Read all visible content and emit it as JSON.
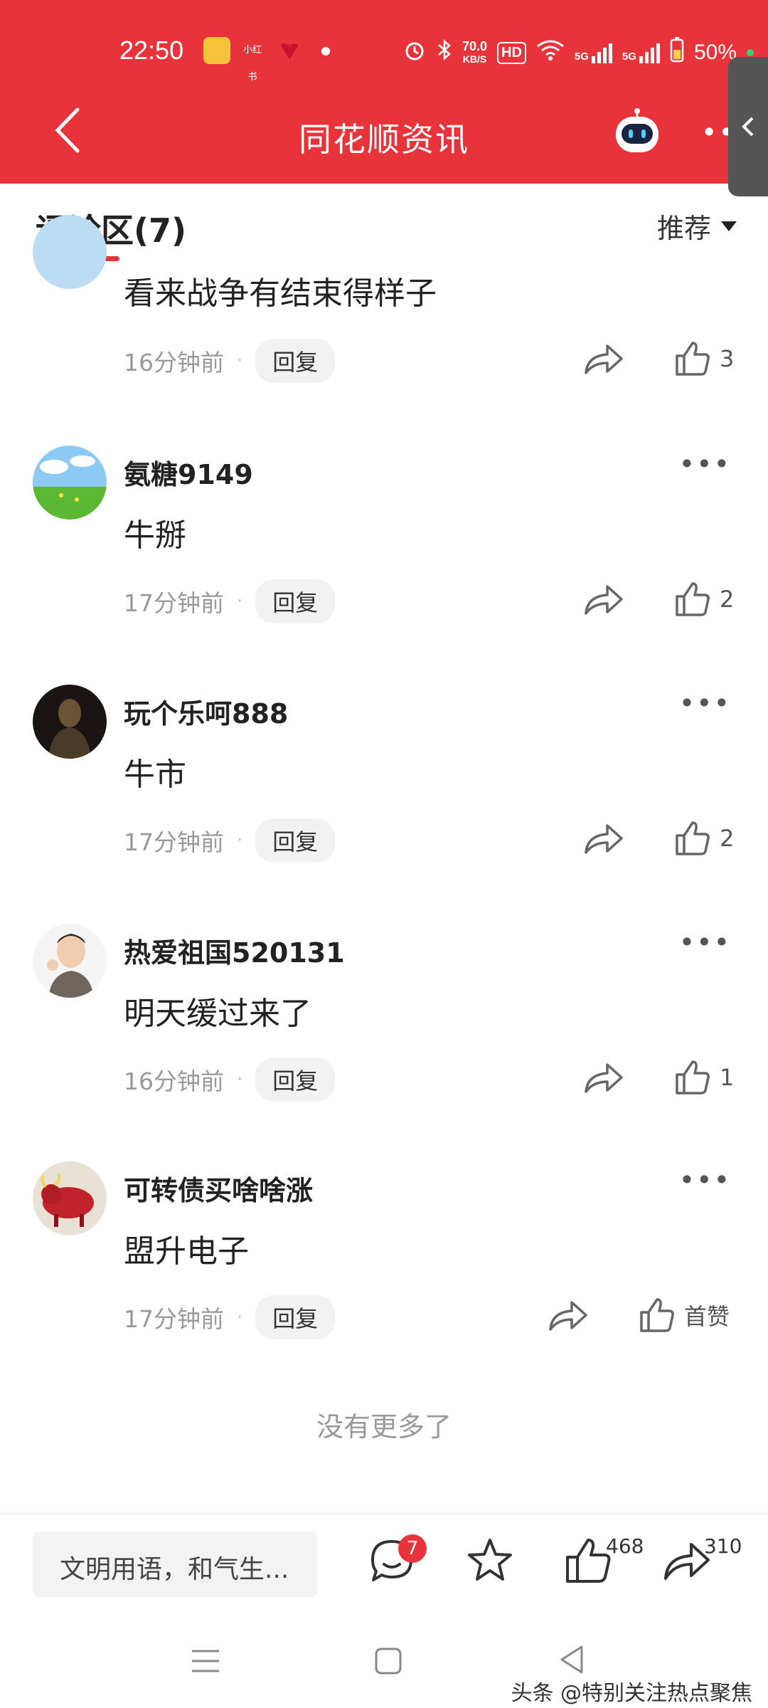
{
  "status_bar": {
    "time": "22:50",
    "dot": "•",
    "speed_value": "70.0",
    "speed_unit": "KB/S",
    "hd_label": "HD",
    "net1": "5G",
    "net2": "5G",
    "battery": "50%",
    "app_badge_2_label": "小红书"
  },
  "nav": {
    "title": "同花顺资讯",
    "more": "•••"
  },
  "comments_header": {
    "label": "评论区(7)",
    "sort_label": "推荐"
  },
  "comments": [
    {
      "username": "",
      "text": "看来战争有结束得样子",
      "time": "16分钟前",
      "reply_label": "回复",
      "likes": "3"
    },
    {
      "username": "氨糖9149",
      "text": "牛掰",
      "time": "17分钟前",
      "reply_label": "回复",
      "likes": "2"
    },
    {
      "username": "玩个乐呵888",
      "text": "牛市",
      "time": "17分钟前",
      "reply_label": "回复",
      "likes": "2"
    },
    {
      "username": "热爱祖国520131",
      "text": "明天缓过来了",
      "time": "16分钟前",
      "reply_label": "回复",
      "likes": "1"
    },
    {
      "username": "可转债买啥啥涨",
      "text": "盟升电子",
      "time": "17分钟前",
      "reply_label": "回复",
      "likes": "首赞"
    }
  ],
  "separator": "·",
  "more_icon_text": "•••",
  "no_more": "没有更多了",
  "bottom_bar": {
    "input_placeholder": "文明用语，和气生...",
    "comment_badge": "7",
    "like_count": "468",
    "share_count": "310"
  },
  "watermark": "头条 @特别关注热点聚焦",
  "colors": {
    "brand_red": "#e8333a",
    "muted": "#999999"
  },
  "icons": [
    "back-icon",
    "robot-icon",
    "share-icon",
    "thumb-up-icon",
    "comment-icon",
    "star-icon",
    "menu-icon",
    "home-icon",
    "back-triangle-icon"
  ]
}
